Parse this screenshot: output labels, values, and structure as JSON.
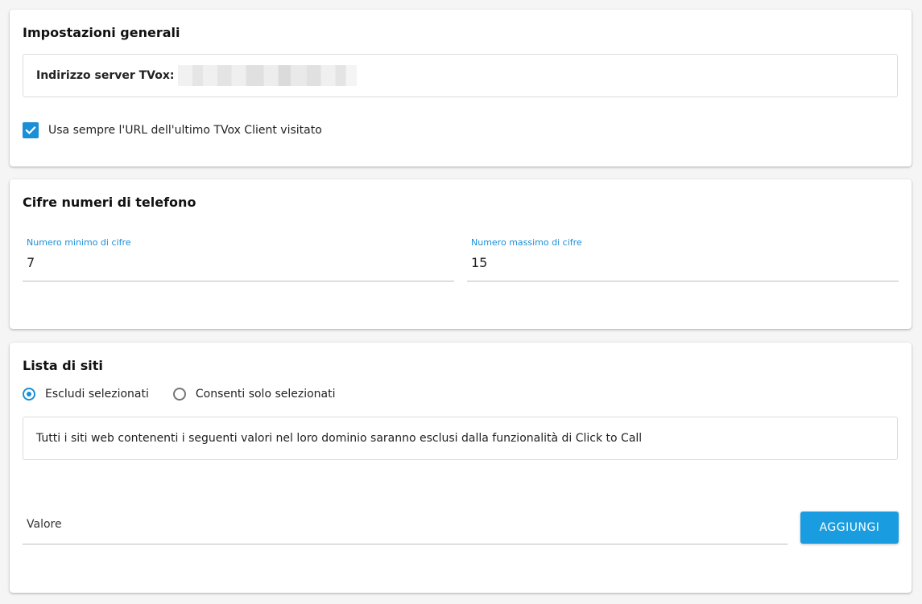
{
  "general": {
    "title": "Impostazioni generali",
    "server_label": "Indirizzo server TVox:",
    "always_use_last_url_label": "Usa sempre l'URL dell'ultimo TVox Client visitato",
    "always_use_last_url_checked": true
  },
  "digits": {
    "title": "Cifre numeri di telefono",
    "min": {
      "label": "Numero minimo di cifre",
      "value": "7"
    },
    "max": {
      "label": "Numero massimo di cifre",
      "value": "15"
    }
  },
  "sites": {
    "title": "Lista di siti",
    "mode_options": [
      {
        "label": "Escludi selezionati",
        "selected": true
      },
      {
        "label": "Consenti solo selezionati",
        "selected": false
      }
    ],
    "description": "Tutti i siti web contenenti i seguenti valori nel loro dominio saranno esclusi dalla funzionalità di Click to Call",
    "value_placeholder": "Valore",
    "add_button_label": "AGGIUNGI"
  },
  "colors": {
    "accent": "#1a8fd8",
    "button": "#1a9de0",
    "background": "#f5f5f5"
  }
}
